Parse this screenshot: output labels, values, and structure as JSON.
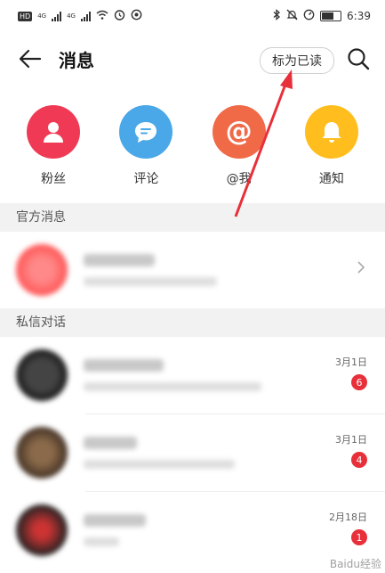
{
  "status_bar": {
    "time": "6:39",
    "hd": "HD",
    "net1": "4G",
    "net2": "4G"
  },
  "header": {
    "title": "消息",
    "mark_read_label": "标为已读"
  },
  "categories": [
    {
      "label": "粉丝",
      "icon": "person-icon",
      "color": "#f03a55"
    },
    {
      "label": "评论",
      "icon": "chat-bubble-icon",
      "color": "#4aa8e8"
    },
    {
      "label": "@我",
      "icon": "at-sign-icon",
      "color": "#f06a48"
    },
    {
      "label": "通知",
      "icon": "bell-icon",
      "color": "#ffbe1e"
    }
  ],
  "official": {
    "heading": "官方消息"
  },
  "private": {
    "heading": "私信对话",
    "items": [
      {
        "date": "3月1日",
        "badge": "6"
      },
      {
        "date": "3月1日",
        "badge": "4"
      },
      {
        "date": "2月18日",
        "badge": "1"
      }
    ]
  },
  "watermark": "Baidu经验"
}
